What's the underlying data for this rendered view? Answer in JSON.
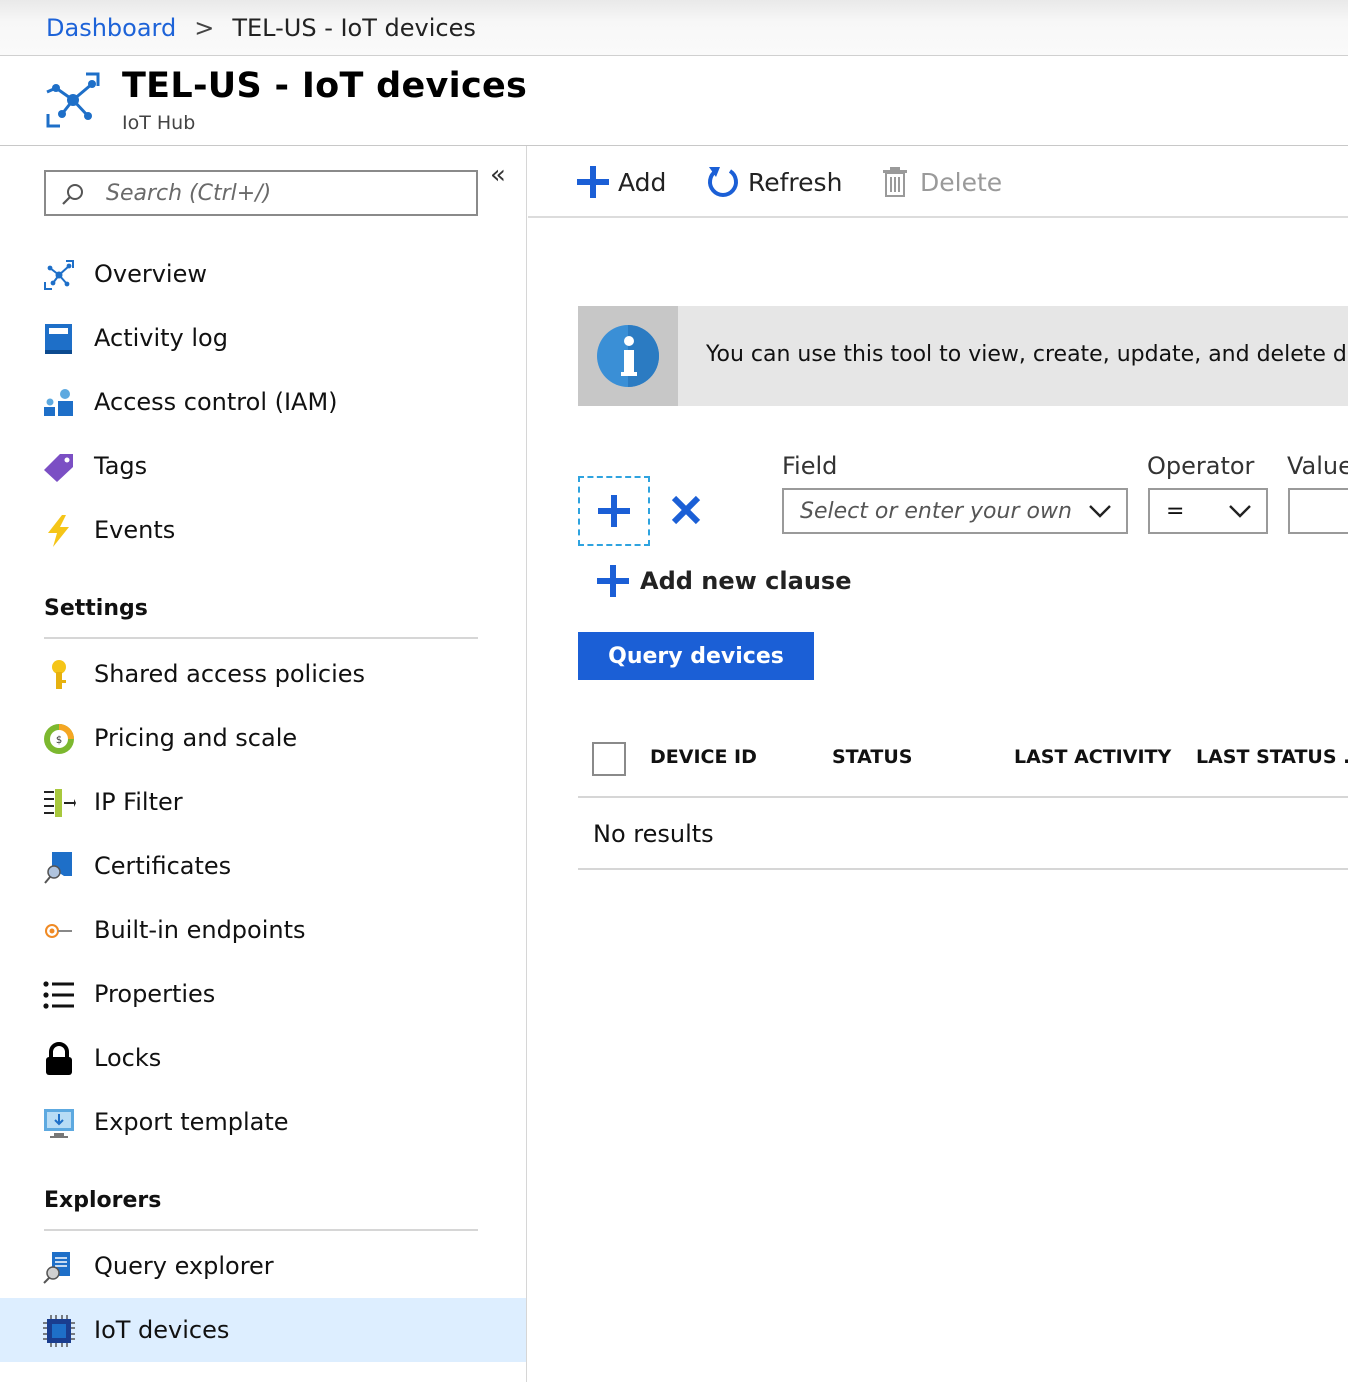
{
  "breadcrumb": {
    "link": "Dashboard",
    "separator": ">",
    "current": "TEL-US - IoT devices"
  },
  "header": {
    "title": "TEL-US - IoT devices",
    "subtitle": "IoT Hub"
  },
  "sidebar": {
    "collapse_glyph": "«",
    "search_placeholder": "Search (Ctrl+/)",
    "items": [
      {
        "label": "Overview",
        "icon": "hub-icon"
      },
      {
        "label": "Activity log",
        "icon": "book-icon"
      },
      {
        "label": "Access control (IAM)",
        "icon": "people-icon"
      },
      {
        "label": "Tags",
        "icon": "tag-icon"
      },
      {
        "label": "Events",
        "icon": "lightning-icon"
      }
    ],
    "settings_title": "Settings",
    "settings": [
      {
        "label": "Shared access policies",
        "icon": "key-icon"
      },
      {
        "label": "Pricing and scale",
        "icon": "pricing-icon"
      },
      {
        "label": "IP Filter",
        "icon": "ip-filter-icon"
      },
      {
        "label": "Certificates",
        "icon": "certificate-icon"
      },
      {
        "label": "Built-in endpoints",
        "icon": "endpoint-icon"
      },
      {
        "label": "Properties",
        "icon": "list-icon"
      },
      {
        "label": "Locks",
        "icon": "lock-icon"
      },
      {
        "label": "Export template",
        "icon": "export-icon"
      }
    ],
    "explorers_title": "Explorers",
    "explorers": [
      {
        "label": "Query explorer",
        "icon": "query-explorer-icon"
      },
      {
        "label": "IoT devices",
        "icon": "chip-icon",
        "active": true
      }
    ]
  },
  "toolbar": {
    "add": "Add",
    "refresh": "Refresh",
    "delete": "Delete"
  },
  "info": {
    "text": "You can use this tool to view, create, update, and delete devices on your IoT Hub."
  },
  "query": {
    "field_label": "Field",
    "field_placeholder": "Select or enter your own",
    "operator_label": "Operator",
    "operator_value": "=",
    "value_label": "Value",
    "add_clause": "Add new clause",
    "query_button": "Query devices"
  },
  "table": {
    "columns": [
      "DEVICE ID",
      "STATUS",
      "LAST ACTIVITY",
      "LAST STATUS ..."
    ],
    "empty": "No results"
  },
  "colors": {
    "accent": "#1b5fd6",
    "link": "#1d63d8",
    "active_bg": "#ddeeff"
  }
}
